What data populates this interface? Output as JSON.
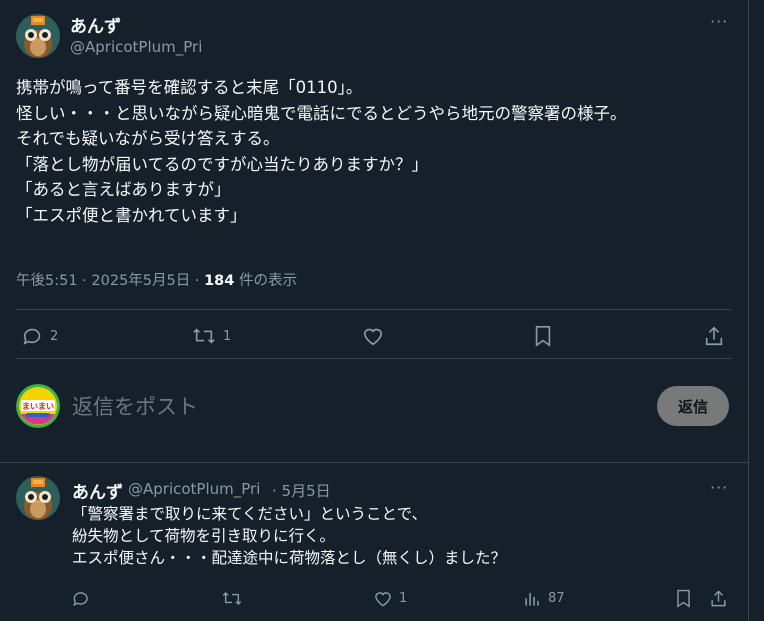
{
  "main_tweet": {
    "author_name": "あんず",
    "author_handle": "@ApricotPlum_Pri",
    "more_label": "···",
    "body": "携帯が鳴って番号を確認すると末尾「0110」。\n怪しい・・・と思いながら疑心暗鬼で電話にでるとどうやら地元の警察署の様子。\nそれでも疑いながら受け答えする。\n「落とし物が届いてるのですが心当たりありますか？」\n「あると言えばありますが」\n「エスポ便と書かれています」",
    "timestamp": "午後5:51 · 2025年5月5日 · ",
    "views_count": "184",
    "views_label": " 件の表示",
    "actions": {
      "reply_count": "2",
      "retweet_count": "1"
    }
  },
  "composer": {
    "placeholder": "返信をポスト",
    "avatar_text": "まいまい",
    "reply_button": "返信"
  },
  "reply_tweet": {
    "author_name": "あんず",
    "author_handle": "@ApricotPlum_Pri",
    "date": "· 5月5日",
    "more_label": "···",
    "body": "「警察署まで取りに来てください」ということで、\n紛失物として荷物を引き取りに行く。\nエスポ便さん・・・配達途中に荷物落とし（無くし）ました？",
    "actions": {
      "like_count": "1",
      "views_count": "87"
    }
  },
  "colors": {
    "background": "#15202b",
    "text_primary": "#f7f9f9",
    "text_secondary": "#8b98a5",
    "divider": "#38444d",
    "reply_button_bg": "#787a7a"
  }
}
